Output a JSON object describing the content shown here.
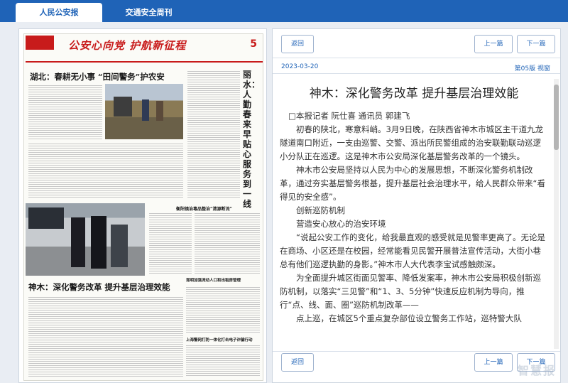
{
  "tabs": [
    {
      "label": "人民公安报",
      "active": true
    },
    {
      "label": "交通安全周刊",
      "active": false
    }
  ],
  "newspaper": {
    "slogan": "公安心向党 护航新征程",
    "page_number": "5",
    "headline_top": "湖北：春耕无小事 “田间警务”护农安",
    "headline_right": "丽水：人勤春来早 贴心服务到一线",
    "headline_main": "神木：深化警务改革 提升基层治理效能",
    "headline_small1": "衡阳镇治毒品整治“清源断流”",
    "headline_small2": "昆明加强流动人口和出租房管理",
    "headline_small3": "上海警网打防一体化打击电子诈骗行动"
  },
  "toolbar": {
    "back_label": "返回",
    "prev_label": "上一篇",
    "next_label": "下一篇"
  },
  "article": {
    "date": "2023-03-20",
    "section": "第05版 视窗",
    "title": "神木：深化警务改革 提升基层治理效能",
    "paragraphs": [
      "□本报记者 阮仕喜 通讯员 郭建飞",
      "初春的陕北，寒意料峭。3月9日晚，在陕西省神木市城区主干道九龙隧道南口附近，一支由巡警、交警、派出所民警组成的治安联勤联动巡逻小分队正在巡逻。这是神木市公安局深化基层警务改革的一个镜头。",
      "神木市公安局坚持以人民为中心的发展思想，不断深化警务机制改革，通过夯实基层警务根基，提升基层社会治理水平，给人民群众带来“看得见的安全感”。",
      "创新巡防机制",
      "营造安心放心的治安环境",
      "“说起公安工作的变化，给我最直观的感受就是见警率更高了。无论是在商场、小区还是在校园，经常能看见民警开展普法宣传活动，大街小巷总有他们巡逻执勤的身影。”神木市人大代表李宝试感触颇深。",
      "为全面提升城区街面见警率、降低发案率，神木市公安局积极创新巡防机制，以落实“三见警”和“1、3、5分钟”快速反应机制为导向，推行“点、线、面、圈”巡防机制改革——",
      "点上巡，在城区5个重点复杂部位设立警务工作站，巡特警大队"
    ]
  },
  "watermark": "智慧报"
}
